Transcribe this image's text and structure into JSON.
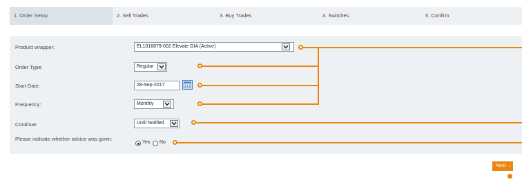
{
  "steps": [
    {
      "label": "1. Order Setup"
    },
    {
      "label": "2. Sell Trades"
    },
    {
      "label": "3. Buy Trades"
    },
    {
      "label": "4. Switches"
    },
    {
      "label": "5. Confirm"
    }
  ],
  "form": {
    "product_wrapper": {
      "label": "Product wrapper:",
      "value": "EL1016879-002 Elevate GIA (Active)"
    },
    "order_type": {
      "label": "Order Type:",
      "value": "Regular"
    },
    "start_date": {
      "label": "Start Date:",
      "value": "28-Sep-2017"
    },
    "frequency": {
      "label": "Frequency:",
      "value": "Monthly"
    },
    "continue": {
      "label": "Continue:",
      "value": "Until Notified"
    },
    "advice": {
      "label": "Please indicate whether advice was given:",
      "yes": "Yes",
      "no": "No",
      "selected": "Yes"
    }
  },
  "next_label": "Next →",
  "colors": {
    "accent": "#e8860e",
    "panel": "#eef1f4",
    "active_step": "#dde2e8"
  }
}
